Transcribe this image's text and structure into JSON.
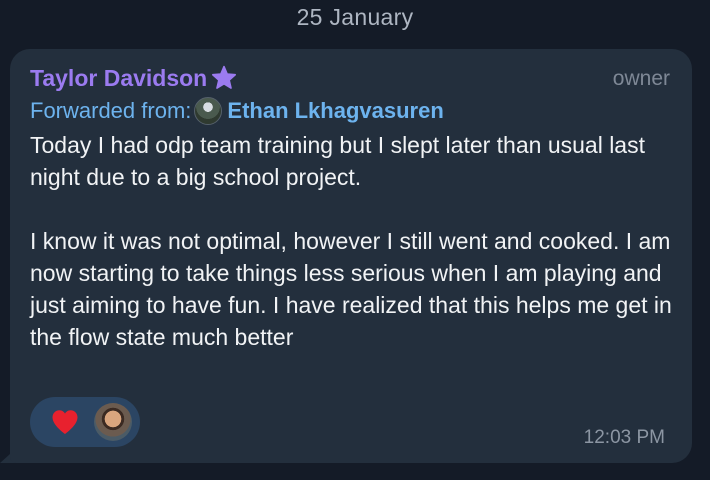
{
  "date_separator": "25 January",
  "message": {
    "sender_name": "Taylor Davidson",
    "sender_color": "#9b7bf0",
    "sender_badge_icon": "star-icon",
    "role": "owner",
    "forwarded_prefix": "Forwarded from:",
    "forwarded_from": "Ethan Lkhagvasuren",
    "text": "Today I had odp team training but I slept later than usual last night due to a big school project.\n\nI know it was not optimal, however I still went and cooked. I am now starting to take things less serious when I am playing and just aiming to have fun. I have realized that this helps me get in the flow state much better",
    "reaction": {
      "icon": "heart-icon",
      "color": "#e8212e"
    },
    "time": "12:03 PM"
  },
  "colors": {
    "background": "#141b27",
    "bubble": "#232f3d",
    "link": "#6db3ee",
    "reaction_pill": "#2b4563"
  }
}
